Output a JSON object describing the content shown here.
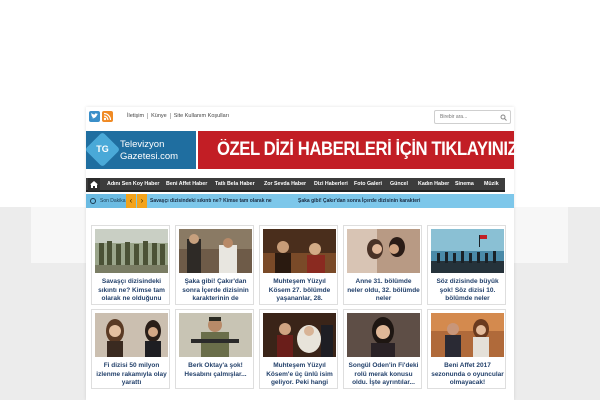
{
  "topbar": {
    "links": [
      "İletişim",
      "Künye",
      "Site Kullanım Koşulları"
    ],
    "search_placeholder": "Birebir ara..."
  },
  "logo": {
    "mark": "TG",
    "line1": "Televizyon",
    "line2": "Gazetesi.com"
  },
  "banner": {
    "text": "ÖZEL DİZİ HABERLERİ İÇİN TIKLAYINIZ --->"
  },
  "nav": {
    "items": [
      "Adını Sen Koy Haber",
      "Beni Affet Haber",
      "Tatlı Bela Haber",
      "Zor Sevda Haber",
      "Dizi Haberleri",
      "Foto Galeri",
      "Güncel",
      "Kadın Haber",
      "Sinema",
      "Müzik"
    ]
  },
  "ticker": {
    "label": "Son Dakika",
    "prev": "‹",
    "next": "›",
    "news": [
      "Savaşçı dizisindeki sıkıntı ne? Kimse tam olarak ne",
      "Şaka gibi! Çakır'dan sonra İçerde dizisinin karakteri"
    ]
  },
  "cards": [
    {
      "caption": "Savaşçı dizisindeki sıkıntı ne? Kimse tam olarak ne olduğunu",
      "icon": "soldiers-photo"
    },
    {
      "caption": "Şaka gibi! Çakır'dan sonra İçerde dizisinin karakterinin de",
      "icon": "actors-photo"
    },
    {
      "caption": "Muhteşem Yüzyıl Kösem 27. bölümde yaşananlar, 28.",
      "icon": "palace-photo"
    },
    {
      "caption": "Anne 31. bölümde neler oldu, 32. bölümde neler",
      "icon": "couple-photo"
    },
    {
      "caption": "Söz dizisinde büyük şok! Söz dizisi 10. bölümde neler",
      "icon": "silhouettes-photo"
    },
    {
      "caption": "Fi dizisi 50 milyon izlenme rakamıyla olay yarattı",
      "icon": "actress-photo"
    },
    {
      "caption": "Berk Oktay'a şok! Hesabını çalmışlar...",
      "icon": "soldier-photo"
    },
    {
      "caption": "Muhteşem Yüzyıl Kösem'e üç ünlü isim geliyor. Peki hangi",
      "icon": "costume-photo"
    },
    {
      "caption": "Songül Öden'in Fi'deki rolü merak konusu oldu. İşte ayrıntılar...",
      "icon": "woman-photo"
    },
    {
      "caption": "Beni Affet 2017 sezonunda o oyuncular olmayacak!",
      "icon": "group-photo"
    }
  ],
  "colors": {
    "banner": "#c21e25",
    "nav": "#3c3c3c",
    "ticker": "#7dc7ea",
    "caption": "#23416b",
    "logo": "#1f6ea0"
  }
}
